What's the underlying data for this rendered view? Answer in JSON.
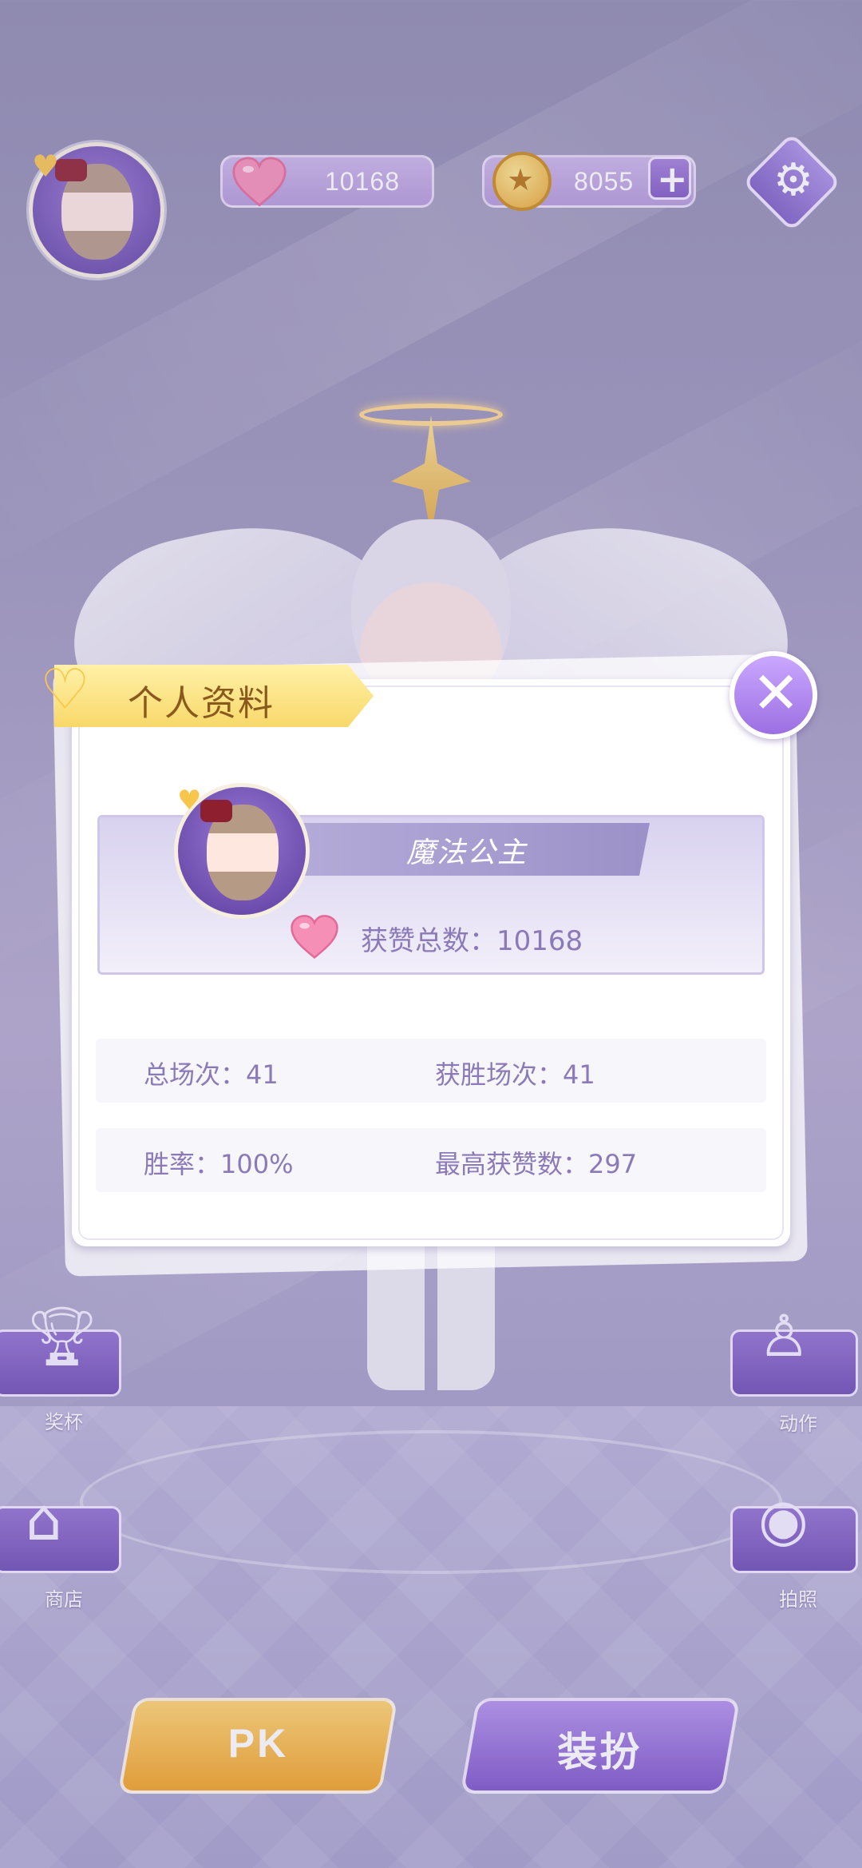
{
  "top_bar": {
    "likes_count": "10168",
    "coins_count": "8055",
    "add_label": "+",
    "settings_icon": "gear-icon"
  },
  "side_menu": {
    "trophy_label": "奖杯",
    "shop_label": "商店",
    "action_label": "动作",
    "photo_label": "拍照"
  },
  "bottom": {
    "pk_label": "PK",
    "dress_up_label": "装扮"
  },
  "profile_dialog": {
    "title": "个人资料",
    "close_label": "✕",
    "player_name": "魔法公主",
    "likes_text": "获赞总数：10168",
    "total_matches": "总场次：41",
    "wins": "获胜场次：41",
    "win_rate": "胜率：100%",
    "max_likes": "最高获赞数：297"
  },
  "colors": {
    "accent_purple": "#9c6fe2",
    "gold": "#f8c64c",
    "text_purple": "#8b7ab8"
  }
}
